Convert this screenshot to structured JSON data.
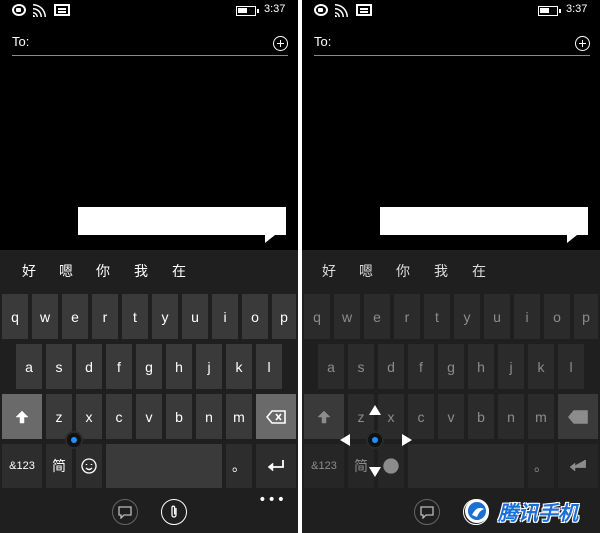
{
  "status_bar": {
    "time": "3:37"
  },
  "compose": {
    "to_label": "To:"
  },
  "candidates": [
    "好",
    "嗯",
    "你",
    "我",
    "在"
  ],
  "keyboard": {
    "row1": [
      "q",
      "w",
      "e",
      "r",
      "t",
      "y",
      "u",
      "i",
      "o",
      "p"
    ],
    "row2": [
      "a",
      "s",
      "d",
      "f",
      "g",
      "h",
      "j",
      "k",
      "l"
    ],
    "row3": [
      "z",
      "x",
      "c",
      "v",
      "b",
      "n",
      "m"
    ],
    "symbols_key": "&123",
    "layout_key": "简",
    "period_key": "。"
  },
  "app_bar": {
    "more": "•••"
  },
  "watermark": {
    "text": "腾讯手机"
  },
  "colors": {
    "accent": "#1e90ff",
    "key": "#3a3a3a",
    "keyboard_bg": "#1f1f1f"
  }
}
